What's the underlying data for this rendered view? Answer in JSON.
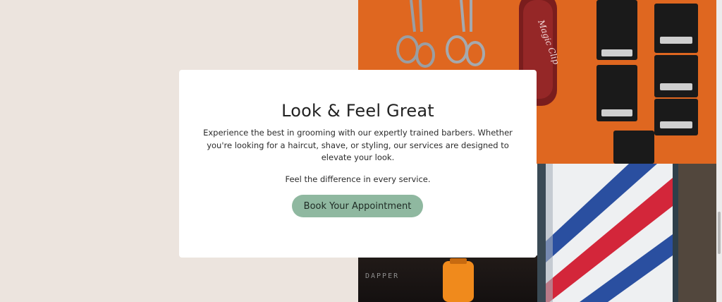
{
  "hero": {
    "title": "Look & Feel Great",
    "body": "Experience the best in grooming with our expertly trained barbers. Whether you're looking for a haircut, shave, or styling, our services are designed to elevate your look.",
    "tagline": "Feel the difference in every service.",
    "cta_label": "Book Your Appointment"
  },
  "photos": {
    "tools_clipper_text": "Magic Clip",
    "bottle_label": "DAPPER"
  },
  "colors": {
    "background": "#ece4de",
    "card": "#ffffff",
    "button": "#8fb8a0",
    "accent_orange": "#e26a22"
  }
}
